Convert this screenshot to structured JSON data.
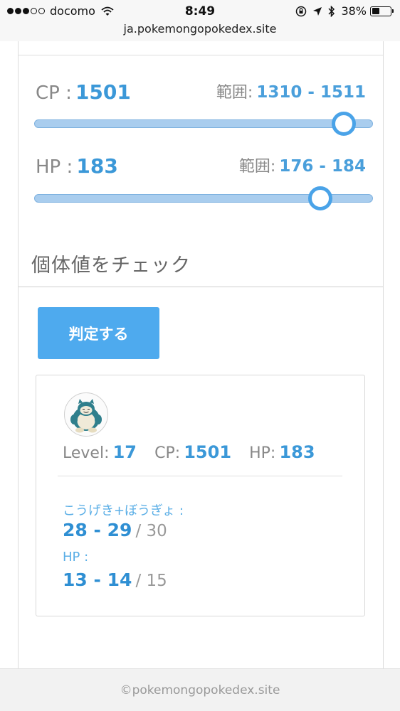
{
  "status_bar": {
    "carrier": "docomo",
    "time": "8:49",
    "battery": "38%",
    "url": "ja.pokemongopokedex.site"
  },
  "cp": {
    "label": "CP :",
    "value": "1501",
    "range_label": "範囲:",
    "range": "1310 - 1511",
    "slider_fraction": 0.915
  },
  "hp": {
    "label": "HP :",
    "value": "183",
    "range_label": "範囲:",
    "range": "176 - 184",
    "slider_fraction": 0.845
  },
  "section": {
    "title": "個体値をチェック"
  },
  "judge_button": {
    "label": "判定する"
  },
  "result": {
    "level_label": "Level:",
    "level": "17",
    "cp_label": "CP:",
    "cp": "1501",
    "hp_label": "HP:",
    "hp": "183",
    "atk_def": {
      "label": "こうげき+ぼうぎょ :",
      "range": "28 - 29",
      "max": "/ 30"
    },
    "hp_iv": {
      "label": "HP :",
      "range": "13 - 14",
      "max": "/ 15"
    }
  },
  "footer": {
    "text": "©pokemongopokedex.site"
  },
  "colors": {
    "accent": "#3b98d8",
    "button": "#4eaaee",
    "slider_track": "#a9cdee"
  }
}
